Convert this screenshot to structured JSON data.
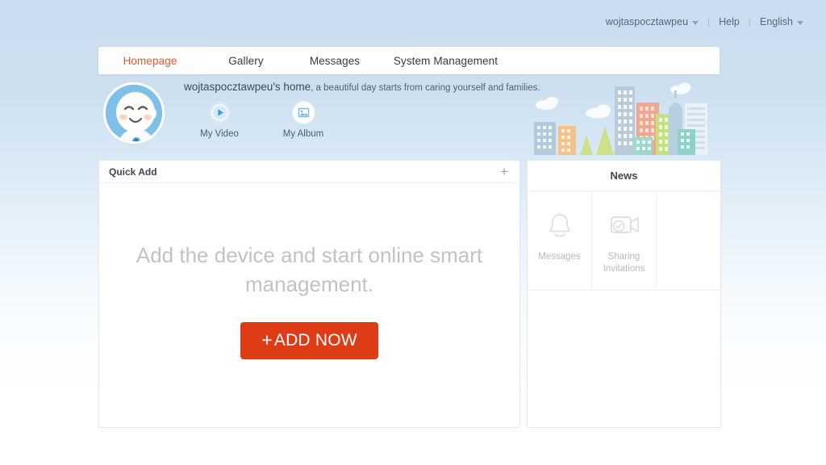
{
  "topbar": {
    "username": "wojtaspocztawpeu",
    "help_label": "Help",
    "language_label": "English",
    "separator": "|",
    "user_caret_icon": "chevron-down-icon",
    "language_caret_icon": "chevron-down-icon"
  },
  "nav": {
    "tabs": [
      {
        "label": "Homepage",
        "active": true
      },
      {
        "label": "Gallery",
        "active": false
      },
      {
        "label": "Messages",
        "active": false
      },
      {
        "label": "System Management",
        "active": false
      }
    ],
    "active_color": "#e4582e"
  },
  "hero": {
    "avatar_icon": "user-avatar-cartoon",
    "greeting_name": "wojtaspocztawpeu's home",
    "greeting_rest": ", a beautiful day starts from caring yourself and families.",
    "quicklinks": [
      {
        "label": "My Video",
        "icon": "play-icon"
      },
      {
        "label": "My Album",
        "icon": "image-icon"
      }
    ],
    "skyline_icon": "city-skyline-illustration"
  },
  "quick_add": {
    "title": "Quick Add",
    "add_icon": "plus-icon",
    "empty_text": "Add the device and start online smart management.",
    "button_plus": "+",
    "button_label": "ADD NOW",
    "button_color": "#dd3c17"
  },
  "news": {
    "title": "News",
    "cells": [
      {
        "label": "Messages",
        "icon": "bell-icon"
      },
      {
        "label": "Sharing Invitations",
        "icon": "camera-check-icon"
      },
      {
        "label": "",
        "icon": ""
      }
    ]
  }
}
